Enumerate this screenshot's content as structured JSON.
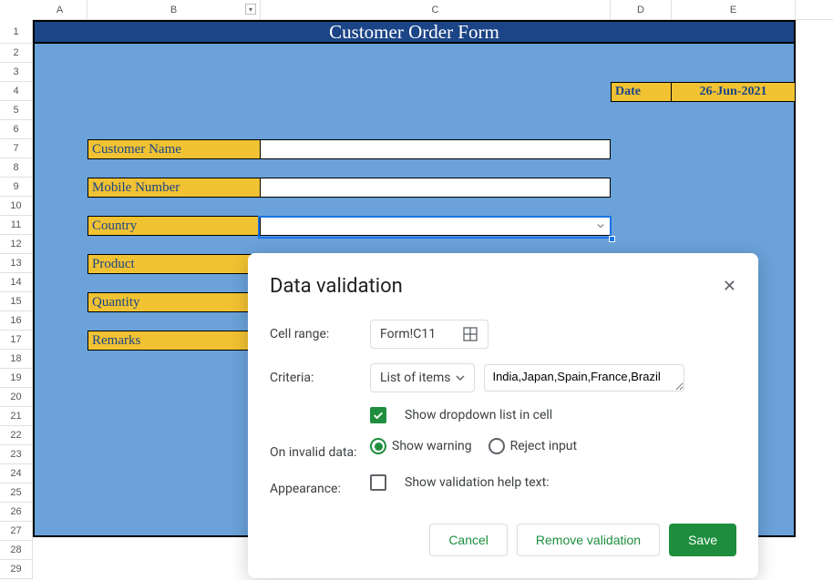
{
  "columns": {
    "A": "A",
    "B": "B",
    "C": "C",
    "D": "D",
    "E": "E"
  },
  "rows": [
    "1",
    "2",
    "3",
    "4",
    "5",
    "6",
    "7",
    "8",
    "9",
    "10",
    "11",
    "12",
    "13",
    "14",
    "15",
    "16",
    "17",
    "18",
    "19",
    "20",
    "21",
    "22",
    "23",
    "24",
    "25",
    "26",
    "27",
    "28",
    "29"
  ],
  "form": {
    "title": "Customer Order Form",
    "date_label": "Date",
    "date_value": "26-Jun-2021",
    "fields": {
      "customer_name": "Customer Name",
      "mobile_number": "Mobile Number",
      "country": "Country",
      "product": "Product",
      "quantity": "Quantity",
      "remarks": "Remarks"
    }
  },
  "dialog": {
    "title": "Data validation",
    "cell_range_label": "Cell range:",
    "cell_range_value": "Form!C11",
    "criteria_label": "Criteria:",
    "criteria_type": "List of items",
    "criteria_value": "India,Japan,Spain,France,Brazil",
    "show_dropdown": "Show dropdown list in cell",
    "invalid_label": "On invalid data:",
    "show_warning": "Show warning",
    "reject_input": "Reject input",
    "appearance_label": "Appearance:",
    "help_text": "Show validation help text:",
    "cancel": "Cancel",
    "remove": "Remove validation",
    "save": "Save"
  }
}
